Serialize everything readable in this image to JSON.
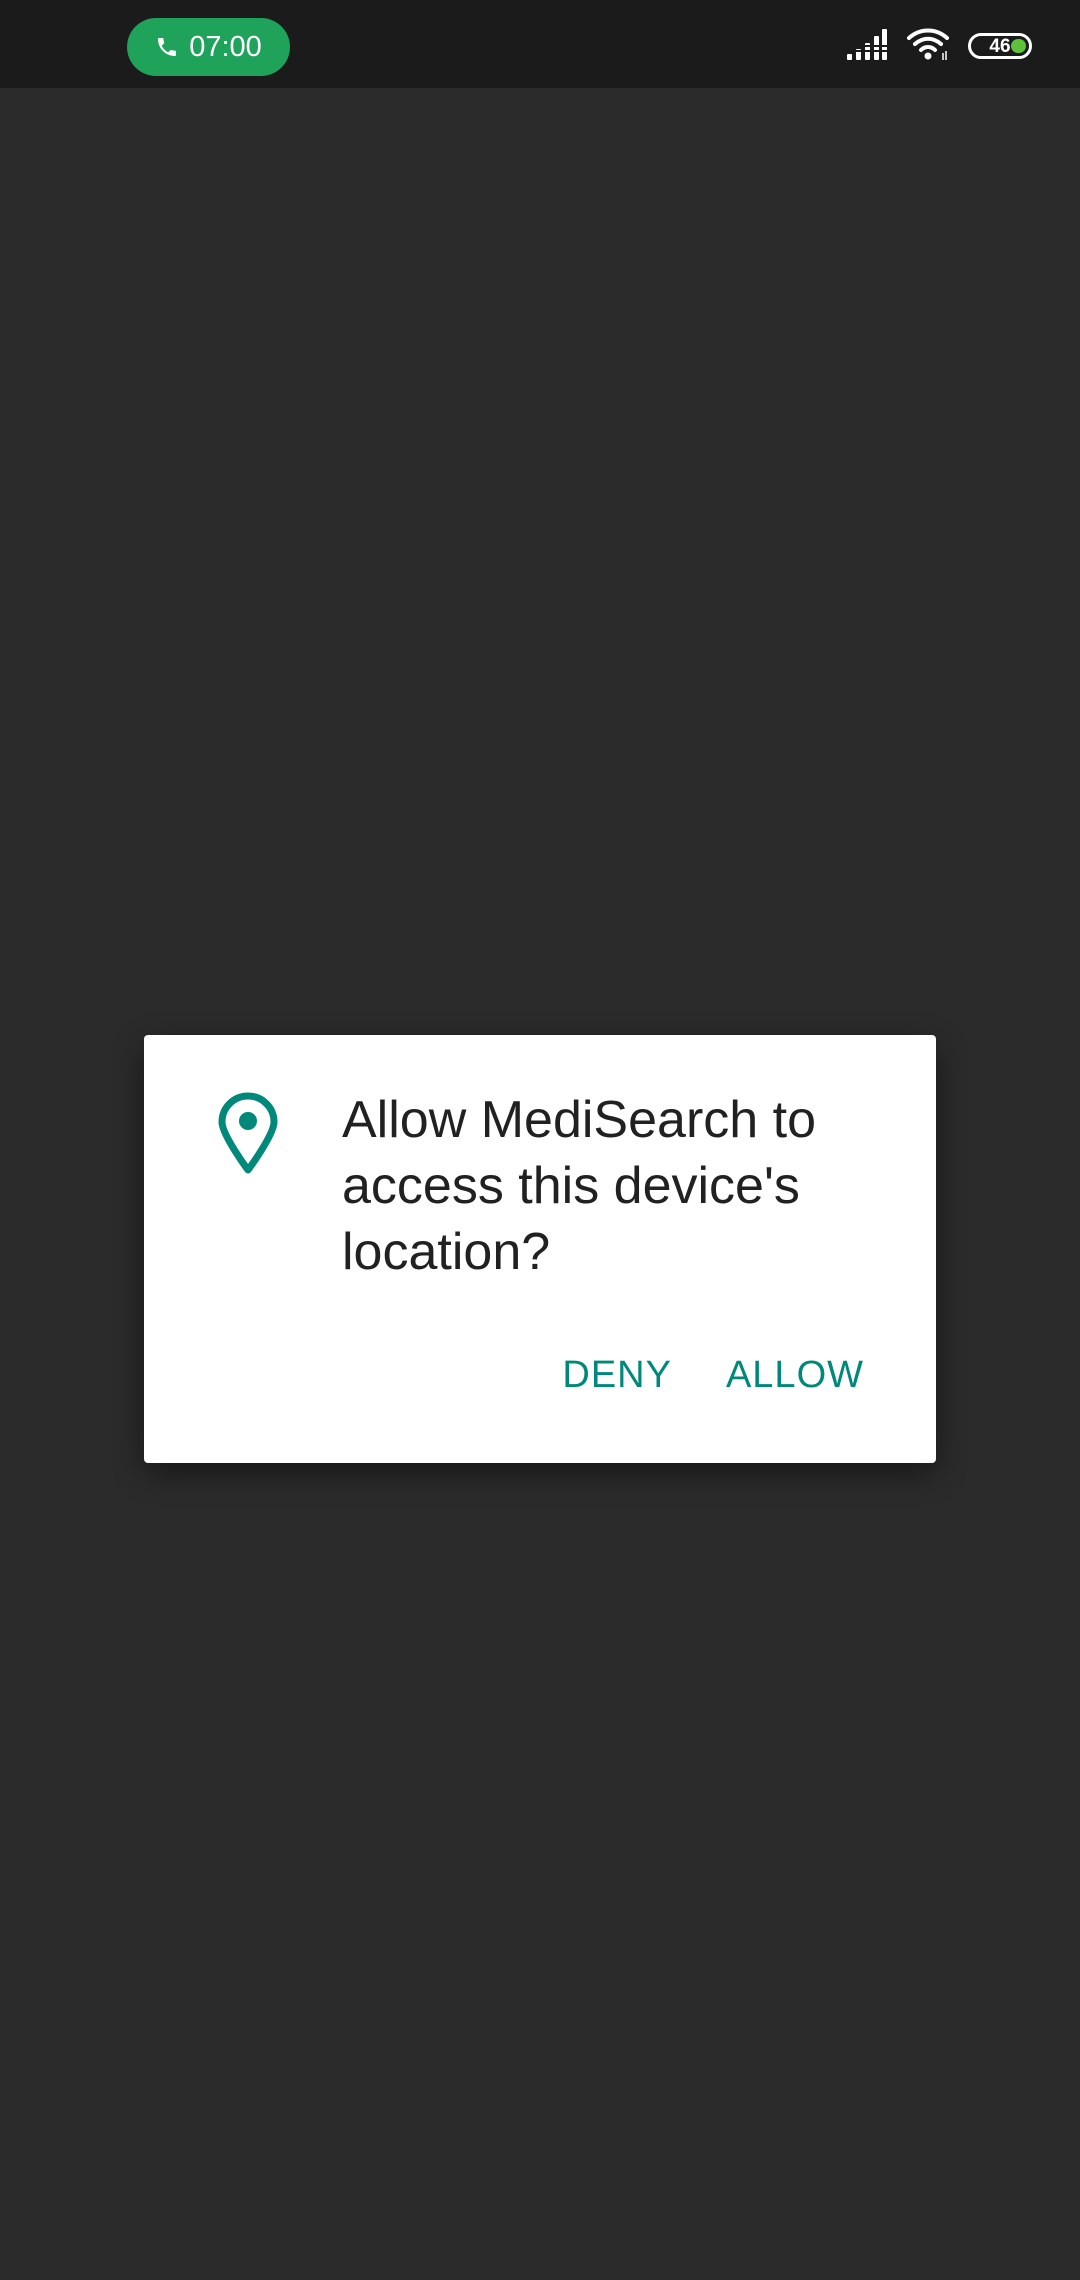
{
  "status_bar": {
    "call_time": "07:00",
    "battery_level": "46",
    "battery_percent": 46,
    "icons": [
      "phone-icon",
      "signal-icon",
      "wifi-icon",
      "battery-icon"
    ]
  },
  "dialog": {
    "icon": "location-pin-icon",
    "message": "Allow MediSearch to access this device's location?",
    "deny_label": "DENY",
    "allow_label": "ALLOW"
  },
  "colors": {
    "accent": "#00897b",
    "call_pill": "#1fa35a",
    "background": "#2b2b2b",
    "status_bar": "#1b1b1b"
  }
}
